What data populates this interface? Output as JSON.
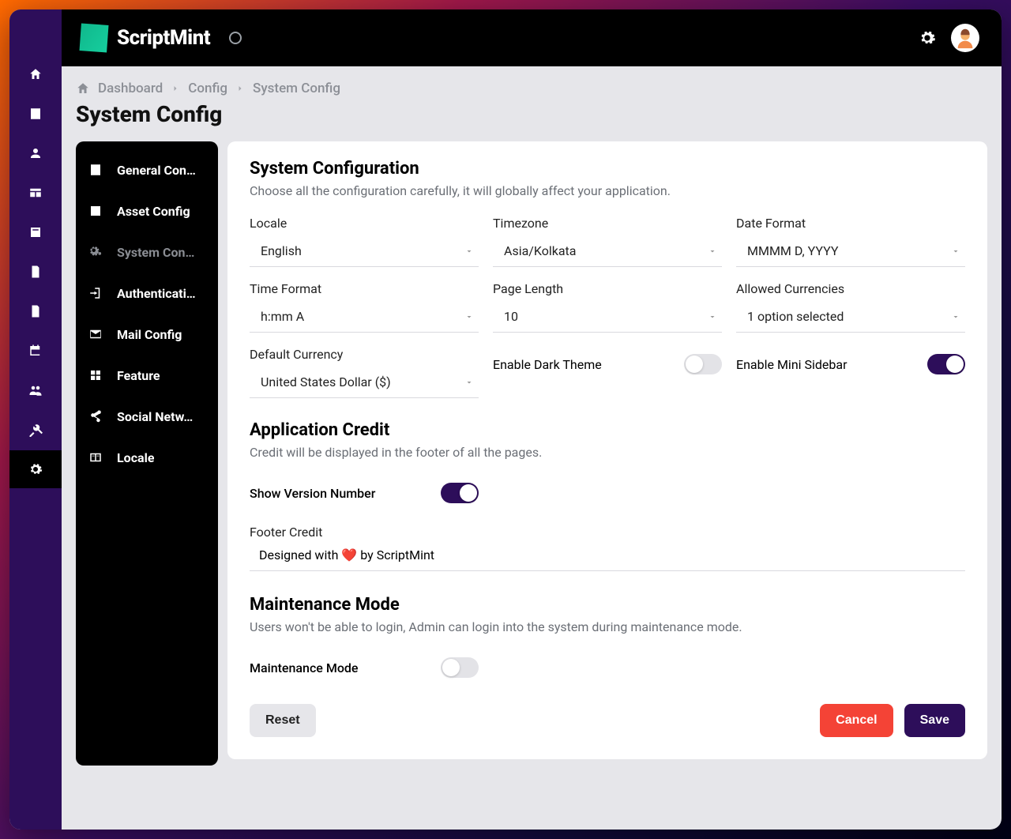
{
  "brand": {
    "name": "ScriptMint"
  },
  "breadcrumb": {
    "home": "Dashboard",
    "parent": "Config",
    "current": "System Config"
  },
  "page_title": "System Config",
  "config_nav": {
    "items": [
      {
        "label": "General Con…"
      },
      {
        "label": "Asset Config"
      },
      {
        "label": "System Con…",
        "active": true
      },
      {
        "label": "Authenticati…"
      },
      {
        "label": "Mail Config"
      },
      {
        "label": "Feature"
      },
      {
        "label": "Social Netw…"
      },
      {
        "label": "Locale"
      }
    ]
  },
  "panel": {
    "system": {
      "title": "System Configuration",
      "subtitle": "Choose all the configuration carefully, it will globally affect your application.",
      "fields": {
        "locale": {
          "label": "Locale",
          "value": "English"
        },
        "timezone": {
          "label": "Timezone",
          "value": "Asia/Kolkata"
        },
        "date_format": {
          "label": "Date Format",
          "value": "MMMM D, YYYY"
        },
        "time_format": {
          "label": "Time Format",
          "value": "h:mm A"
        },
        "page_length": {
          "label": "Page Length",
          "value": "10"
        },
        "allowed_currencies": {
          "label": "Allowed Currencies",
          "value": "1 option selected"
        },
        "default_currency": {
          "label": "Default Currency",
          "value": "United States Dollar ($)"
        },
        "enable_dark_theme": {
          "label": "Enable Dark Theme",
          "on": false
        },
        "enable_mini_sidebar": {
          "label": "Enable Mini Sidebar",
          "on": true
        }
      }
    },
    "credit": {
      "title": "Application Credit",
      "subtitle": "Credit will be displayed in the footer of all the pages.",
      "show_version": {
        "label": "Show Version Number",
        "on": true
      },
      "footer_credit": {
        "label": "Footer Credit",
        "value": "Designed with ❤️ by ScriptMint"
      }
    },
    "maintenance": {
      "title": "Maintenance Mode",
      "subtitle": "Users won't be able to login, Admin can login into the system during maintenance mode.",
      "toggle": {
        "label": "Maintenance Mode",
        "on": false
      }
    }
  },
  "actions": {
    "reset": "Reset",
    "cancel": "Cancel",
    "save": "Save"
  }
}
